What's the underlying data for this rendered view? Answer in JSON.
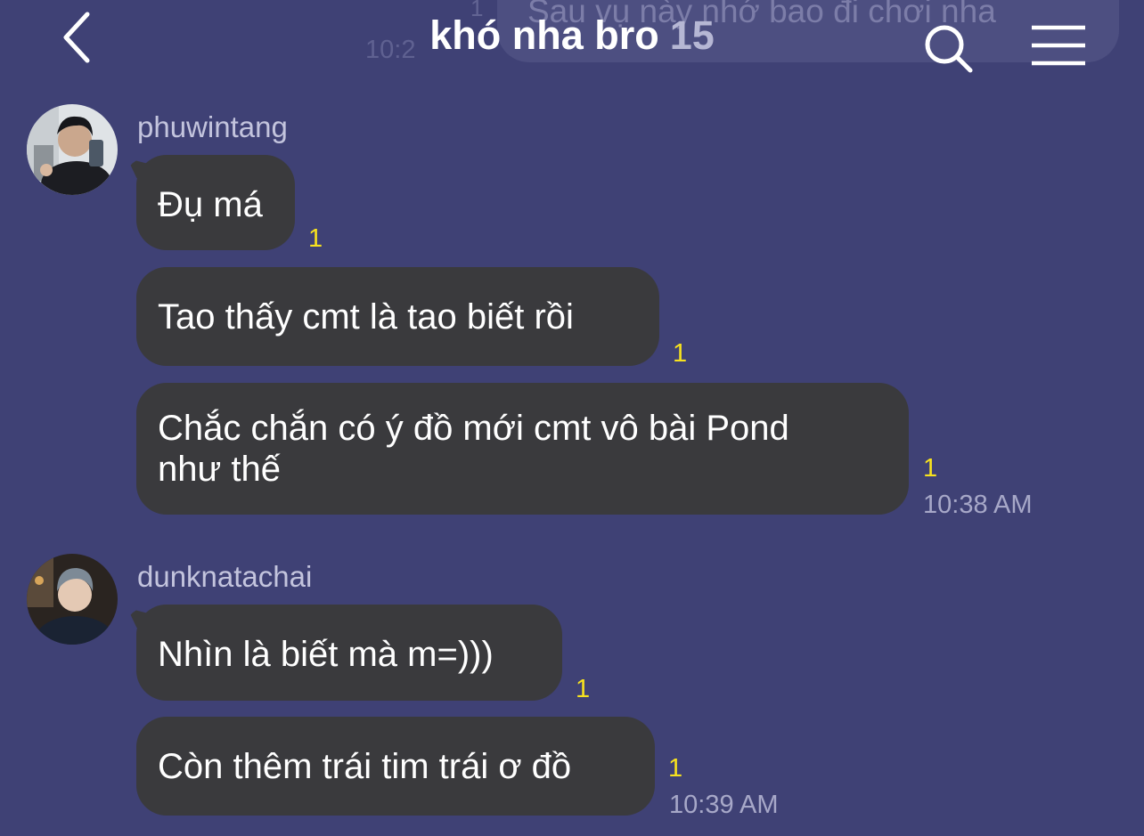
{
  "ghost": {
    "text": "Sau vụ này nhớ bao đi chơi nha",
    "read_count": "1",
    "time": "10:2"
  },
  "header": {
    "title": "khó nha bro",
    "member_count": "15",
    "icons": {
      "back": "back-arrow-icon",
      "search": "search-icon",
      "menu": "hamburger-menu-icon"
    }
  },
  "messages": [
    {
      "sender": "phuwintang",
      "items": [
        {
          "text": "Đụ má",
          "read_count": "1"
        },
        {
          "text": "Tao thấy cmt là tao biết rồi",
          "read_count": "1"
        },
        {
          "text_lines": [
            "Chắc chắn có ý đồ mới cmt vô bài Pond",
            "như thế"
          ],
          "read_count": "1",
          "time": "10:38 AM"
        }
      ]
    },
    {
      "sender": "dunknatachai",
      "items": [
        {
          "text": "Nhìn là biết mà m=)))",
          "read_count": "1"
        },
        {
          "text": "Còn thêm trái tim trái ơ đồ",
          "read_count": "1",
          "time": "10:39 AM"
        }
      ]
    }
  ],
  "colors": {
    "background": "#3f4175",
    "bubble": "#3a3a3d",
    "read_count": "#f7e21e",
    "timestamp": "#a7a8c8"
  }
}
